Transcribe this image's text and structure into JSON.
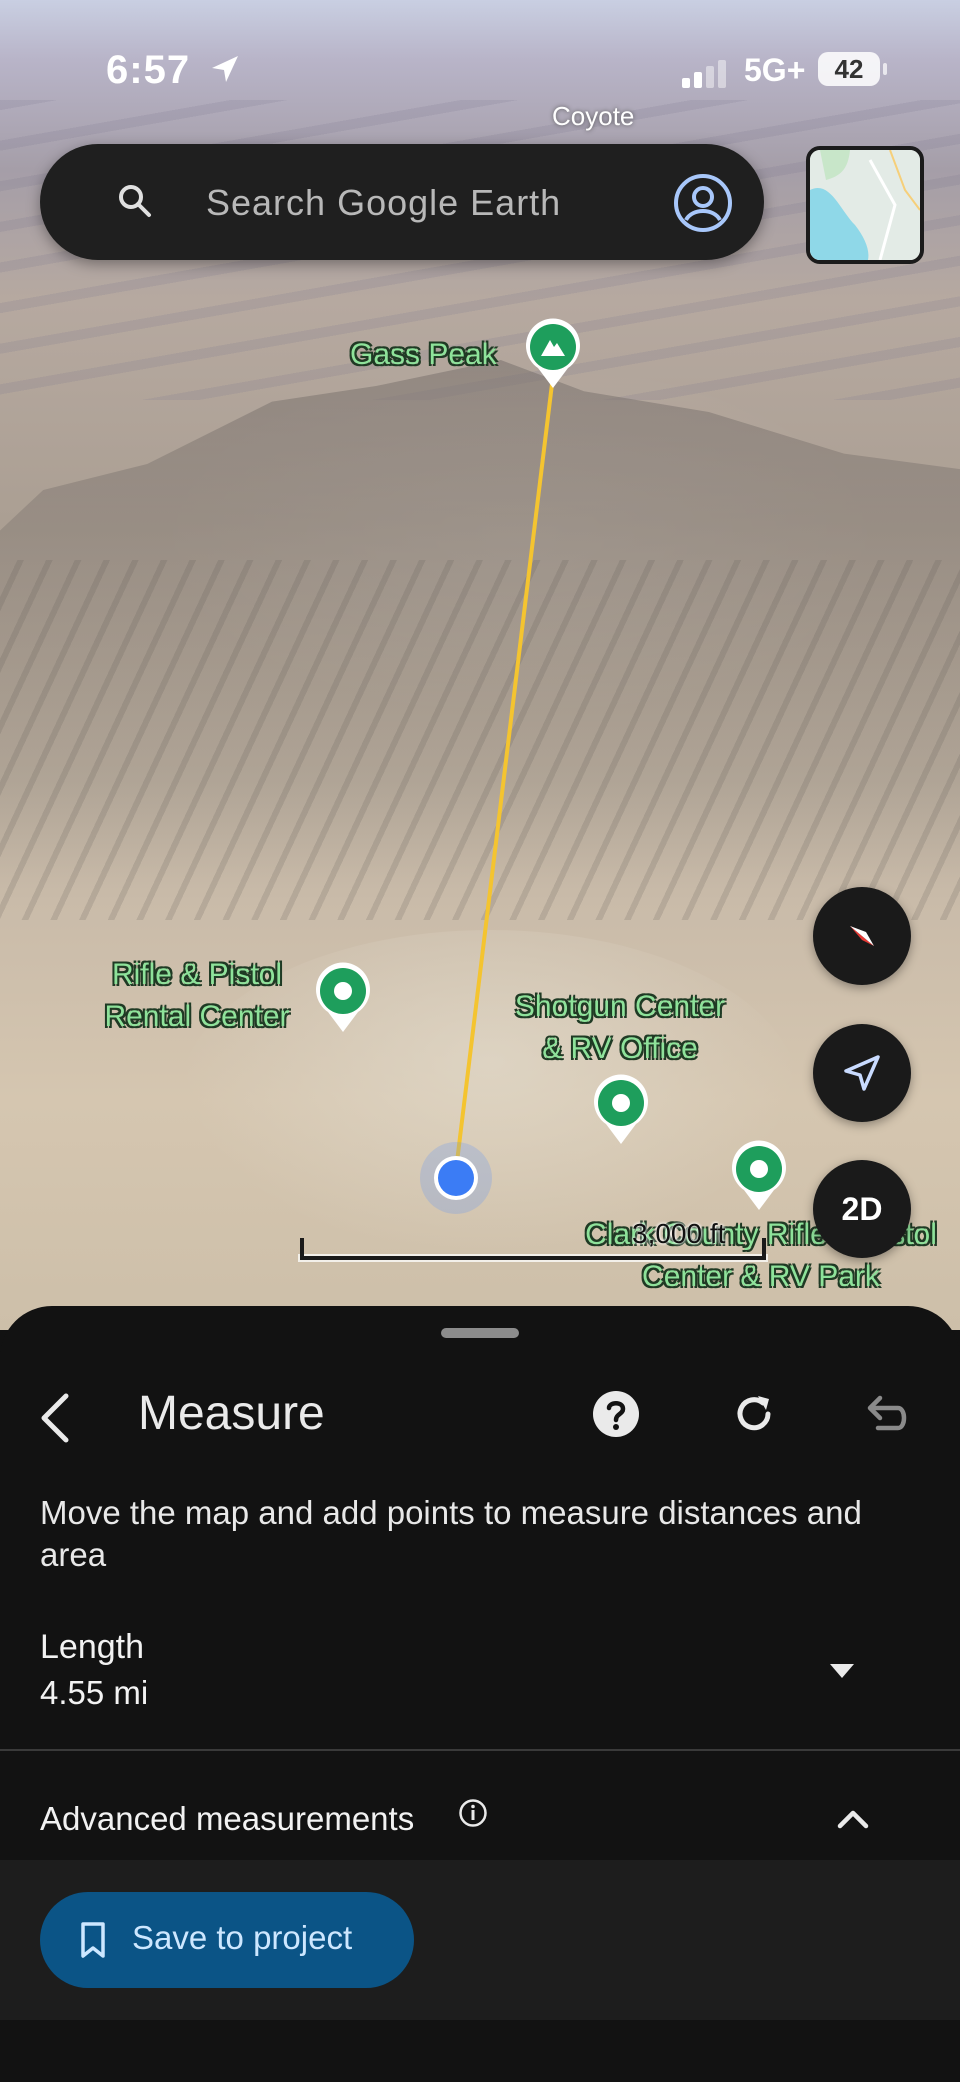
{
  "status_bar": {
    "time": "6:57",
    "network": "5G+",
    "battery": "42"
  },
  "map": {
    "place_labels": {
      "coyote": "Coyote",
      "gass_peak": "Gass Peak",
      "rifle_pistol": [
        "Rifle & Pistol",
        "Rental Center"
      ],
      "shotgun_center": [
        "Shotgun Center",
        "& RV Office"
      ],
      "clark_county": [
        "Clark County Rifle & Pistol",
        "Center & RV Park"
      ]
    },
    "scale_label": "3,000 ft",
    "measure_line_color": "#f4c430",
    "pin_color": "#1e9e5c",
    "current_point_color": "#3b7cf5"
  },
  "search": {
    "placeholder": "Search Google Earth"
  },
  "controls": {
    "compass": "compass-icon",
    "my_location": "navigation-arrow-icon",
    "view_mode": "2D"
  },
  "measure_panel": {
    "title": "Measure",
    "instructions": "Move the map and add points to measure distances and area",
    "length_label": "Length",
    "length_value": "4.55 mi",
    "advanced_label": "Advanced measurements",
    "save_label": "Save to project"
  }
}
